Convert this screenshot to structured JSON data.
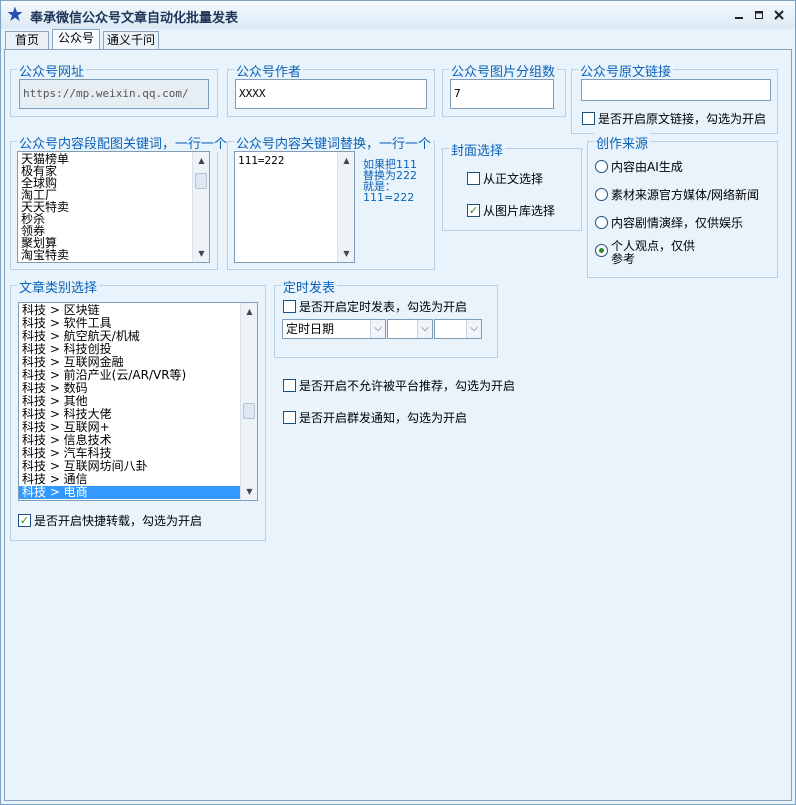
{
  "window": {
    "title": "奉承微信公众号文章自动化批量发表",
    "minimize_icon": "minimize-icon",
    "maximize_icon": "maximize-icon",
    "close_icon": "close-icon",
    "app_icon": "star-icon",
    "accent_color": "#0a62b8"
  },
  "tabs": [
    {
      "label": "首页",
      "active": false
    },
    {
      "label": "公众号",
      "active": true
    },
    {
      "label": "通义千问",
      "active": false
    }
  ],
  "url_group": {
    "title": "公众号网址",
    "value": "https://mp.weixin.qq.com/"
  },
  "author_group": {
    "title": "公众号作者",
    "value": "XXXX"
  },
  "image_group": {
    "title": "公众号图片分组数",
    "value": "7"
  },
  "original_link_group": {
    "title": "公众号原文链接",
    "value": "",
    "checkbox_label": "是否开启原文链接，勾选为开启",
    "checked": false
  },
  "image_keywords_group": {
    "title": "公众号内容段配图关键词，一行一个",
    "items": [
      "天猫榜单",
      "极有家",
      "全球购",
      "淘工厂",
      "天天特卖",
      "秒杀",
      "领券",
      "聚划算",
      "淘宝特卖"
    ]
  },
  "replace_group": {
    "title": "公众号内容关键词替换，一行一个",
    "value": "111=222",
    "hint_lines": [
      "如果把111",
      "替换为222",
      "就是：",
      "111=222"
    ]
  },
  "cover_group": {
    "title": "封面选择",
    "options": [
      {
        "label": "从正文选择",
        "checked": false
      },
      {
        "label": "从图片库选择",
        "checked": true
      }
    ]
  },
  "source_group": {
    "title": "创作来源",
    "options": [
      {
        "label": "内容由AI生成",
        "selected": false
      },
      {
        "label": "素材来源官方媒体/网络新闻",
        "selected": false
      },
      {
        "label": "内容剧情演绎，仅供娱乐",
        "selected": false
      },
      {
        "label": "个人观点，仅供",
        "label2": "参考",
        "selected": true
      }
    ]
  },
  "category_group": {
    "title": "文章类别选择",
    "items": [
      "科技 > 区块链",
      "科技 > 软件工具",
      "科技 > 航空航天/机械",
      "科技 > 科技创投",
      "科技 > 互联网金融",
      "科技 > 前沿产业(云/AR/VR等)",
      "科技 > 数码",
      "科技 > 其他",
      "科技 > 科技大佬",
      "科技 > 互联网+",
      "科技 > 信息技术",
      "科技 > 汽车科技",
      "科技 > 互联网坊间八卦",
      "科技 > 通信",
      "科技 > 电商"
    ],
    "selected_index": 14,
    "checkbox_label": "是否开启快捷转载，勾选为开启",
    "checked": true
  },
  "schedule_group": {
    "title": "定时发表",
    "checkbox_label": "是否开启定时发表，勾选为开启",
    "checked": false,
    "date_label": "定时日期",
    "hour_value": "",
    "minute_value": ""
  },
  "extra_options": [
    {
      "label": "是否开启不允许被平台推荐，勾选为开启",
      "checked": false
    },
    {
      "label": "是否开启群发通知，勾选为开启",
      "checked": false
    }
  ]
}
